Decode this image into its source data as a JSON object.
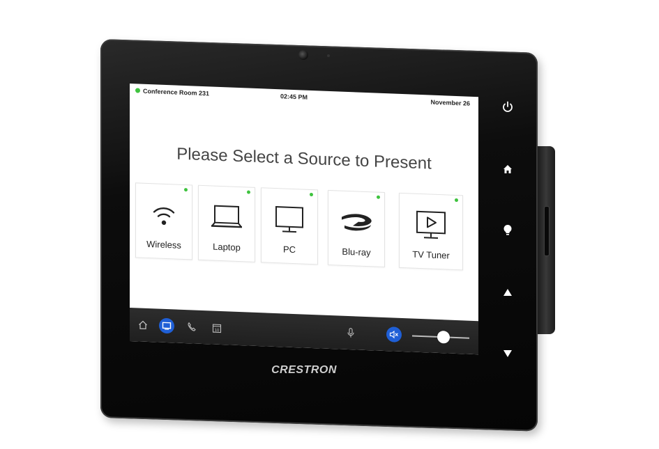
{
  "device": {
    "brand": "CRESTRON",
    "hardkeys": [
      {
        "name": "power-icon"
      },
      {
        "name": "home-icon"
      },
      {
        "name": "lightbulb-icon"
      },
      {
        "name": "arrow-up-icon"
      },
      {
        "name": "arrow-down-icon"
      }
    ]
  },
  "status": {
    "room": "Conference Room 231",
    "time": "02:45 PM",
    "date": "November 26",
    "online_color": "#3fc33f"
  },
  "main": {
    "prompt": "Please Select a Source to Present",
    "sources": [
      {
        "label": "Wireless",
        "icon": "wifi-icon"
      },
      {
        "label": "Laptop",
        "icon": "laptop-icon"
      },
      {
        "label": "PC",
        "icon": "monitor-icon"
      },
      {
        "label": "Blu-ray",
        "icon": "bluray-icon"
      },
      {
        "label": "TV Tuner",
        "icon": "tv-icon"
      }
    ]
  },
  "bottombar": {
    "icons": [
      "home-icon",
      "display-icon",
      "phone-icon",
      "calendar-icon",
      "microphone-icon",
      "mute-icon"
    ],
    "calendar_day": "10",
    "active_color": "#1f5fd6",
    "volume_level": 0.55
  }
}
